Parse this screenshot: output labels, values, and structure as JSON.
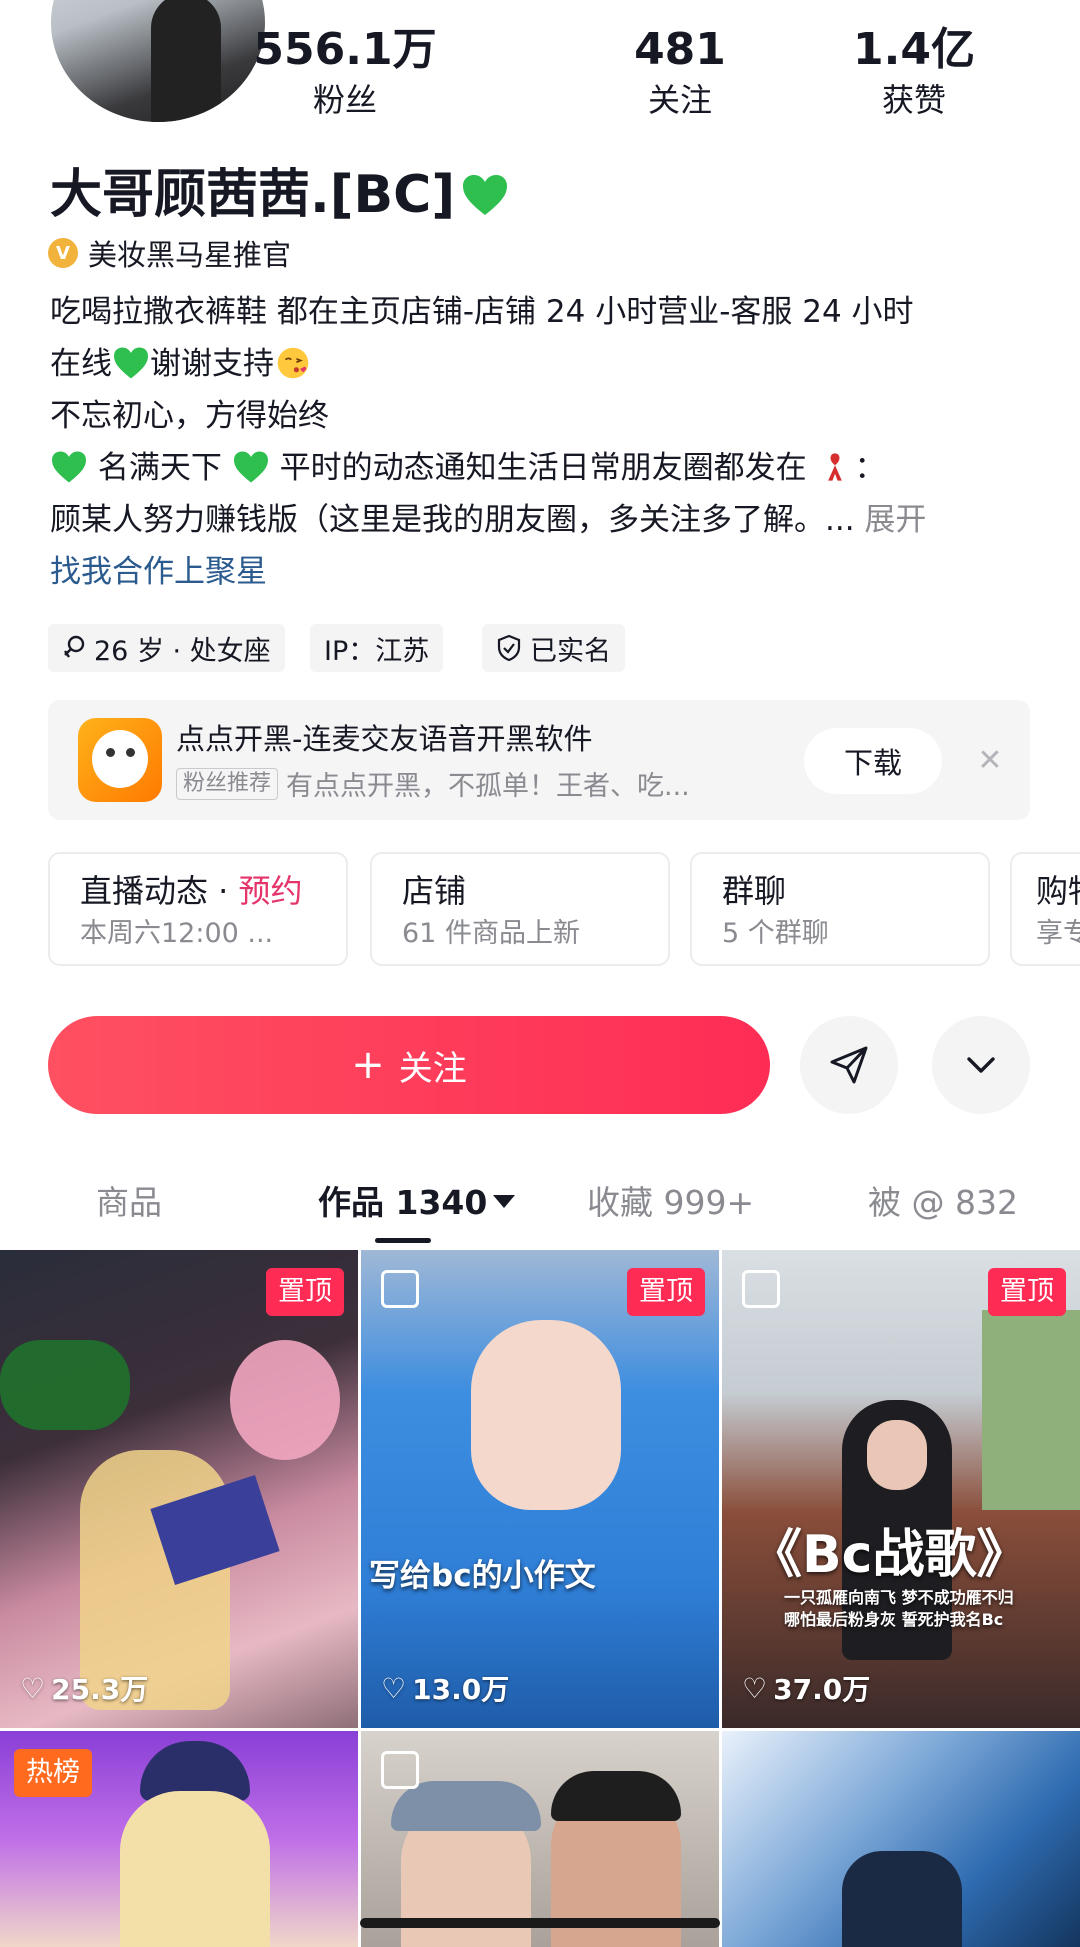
{
  "profile": {
    "name": "大哥顾茜茜.[BC]",
    "verification": "美妆黑马星推官",
    "stats": [
      {
        "value": "556.1万",
        "label": "粉丝"
      },
      {
        "value": "481",
        "label": "关注"
      },
      {
        "value": "1.4亿",
        "label": "获赞"
      }
    ]
  },
  "bio": {
    "line1": "吃喝拉撒衣裤鞋 都在主页店铺-店铺 24 小时营业-客服 24 小时",
    "line2a": "在线",
    "line2b": "谢谢支持",
    "line3": "不忘初心，方得始终",
    "line4a": "名满天下",
    "line4b": "平时的动态通知生活日常朋友圈都发在",
    "line4c": "：",
    "line5": "顾某人努力赚钱版（这里是我的朋友圈，多关注多了解。...",
    "more": "展开",
    "link": "找我合作上聚星"
  },
  "tags": {
    "age": "26 岁 · 处女座",
    "ip": "IP：江苏",
    "verified": "已实名"
  },
  "ad": {
    "title": "点点开黑-连麦交友语音开黑软件",
    "tag": "粉丝推荐",
    "desc": "有点点开黑，不孤单！王者、吃...",
    "button": "下载",
    "close": "✕"
  },
  "cards": [
    {
      "title": "直播动态 · ",
      "title_hl": "预约",
      "sub": "本周六12:00 ..."
    },
    {
      "title": "店铺",
      "sub": "61 件商品上新"
    },
    {
      "title": "群聊",
      "sub": "5 个群聊"
    },
    {
      "title": "购物",
      "sub": "享专"
    }
  ],
  "actions": {
    "follow": "关注",
    "follow_icon": "+"
  },
  "tabs": [
    {
      "label": "商品"
    },
    {
      "label": "作品 1340"
    },
    {
      "label": "收藏 999+"
    },
    {
      "label": "被 @ 832"
    }
  ],
  "videos": [
    {
      "badge": "置顶",
      "likes": "25.3万"
    },
    {
      "badge": "置顶",
      "likes": "13.0万",
      "caption": "写给bc的小作文"
    },
    {
      "badge": "置顶",
      "likes": "37.0万",
      "caption": "《Bc战歌》",
      "subcaption1": "一只孤雁向南飞 梦不成功雁不归",
      "subcaption2": "哪怕最后粉身灰 誓死护我名Bc"
    },
    {
      "badge": "热榜"
    },
    {},
    {}
  ],
  "colors": {
    "accent": "#fe2c55",
    "heart": "#22b14c",
    "link": "#2b5a8e",
    "muted": "#8a8b91"
  }
}
